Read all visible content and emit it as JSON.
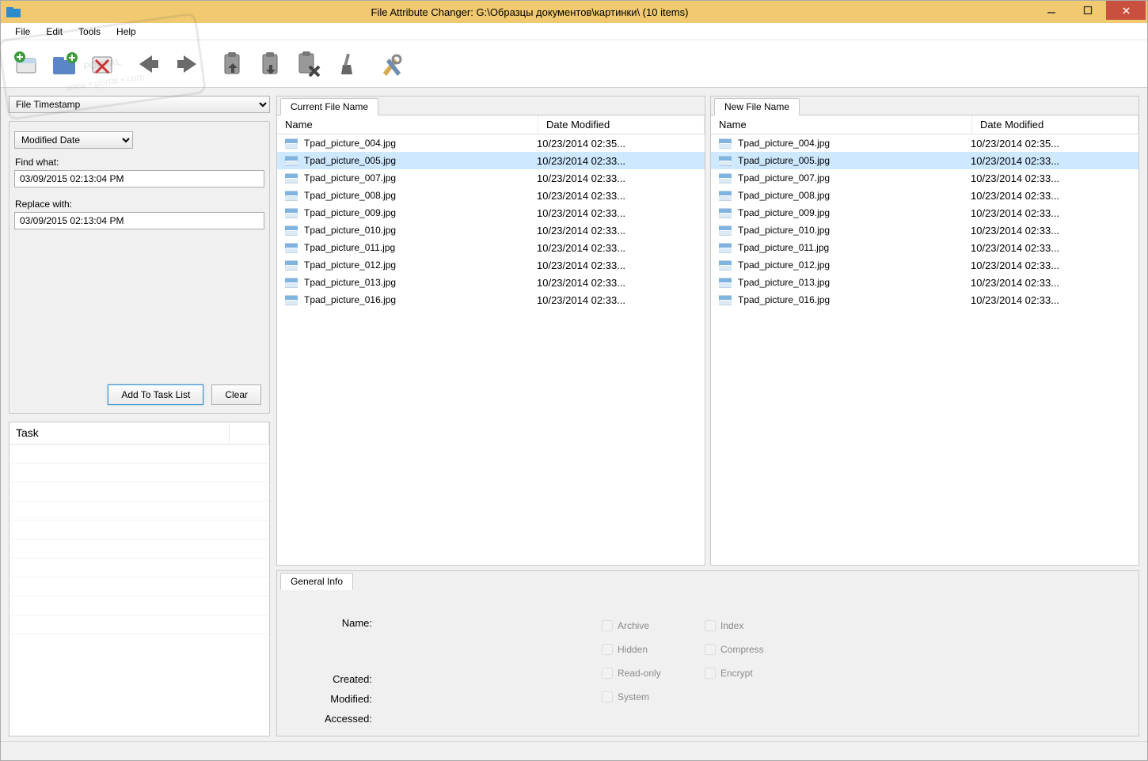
{
  "title": "File Attribute Changer: G:\\Образцы документов\\картинки\\ (10 items)",
  "menu": {
    "file": "File",
    "edit": "Edit",
    "tools": "Tools",
    "help": "Help"
  },
  "leftPanel": {
    "modeSelectValue": "File Timestamp",
    "dateTypeValue": "Modified Date",
    "findLabel": "Find what:",
    "findValue": "03/09/2015 02:13:04 PM",
    "replaceLabel": "Replace with:",
    "replaceValue": "03/09/2015 02:13:04 PM",
    "addBtn": "Add To Task List",
    "clearBtn": "Clear"
  },
  "taskPanel": {
    "header": "Task"
  },
  "pane": {
    "currentTab": "Current File Name",
    "newTab": "New File Name",
    "colName": "Name",
    "colDate": "Date Modified",
    "selectedIndex": 1,
    "rows": [
      {
        "name": "Tpad_picture_004.jpg",
        "date": "10/23/2014 02:35..."
      },
      {
        "name": "Tpad_picture_005.jpg",
        "date": "10/23/2014 02:33..."
      },
      {
        "name": "Tpad_picture_007.jpg",
        "date": "10/23/2014 02:33..."
      },
      {
        "name": "Tpad_picture_008.jpg",
        "date": "10/23/2014 02:33..."
      },
      {
        "name": "Tpad_picture_009.jpg",
        "date": "10/23/2014 02:33..."
      },
      {
        "name": "Tpad_picture_010.jpg",
        "date": "10/23/2014 02:33..."
      },
      {
        "name": "Tpad_picture_011.jpg",
        "date": "10/23/2014 02:33..."
      },
      {
        "name": "Tpad_picture_012.jpg",
        "date": "10/23/2014 02:33..."
      },
      {
        "name": "Tpad_picture_013.jpg",
        "date": "10/23/2014 02:33..."
      },
      {
        "name": "Tpad_picture_016.jpg",
        "date": "10/23/2014 02:33..."
      }
    ]
  },
  "generalInfo": {
    "tab": "General Info",
    "nameLabel": "Name:",
    "createdLabel": "Created:",
    "modifiedLabel": "Modified:",
    "accessedLabel": "Accessed:",
    "attrs": {
      "archive": "Archive",
      "hidden": "Hidden",
      "readonly": "Read-only",
      "system": "System",
      "index": "Index",
      "compress": "Compress",
      "encrypt": "Encrypt"
    }
  }
}
